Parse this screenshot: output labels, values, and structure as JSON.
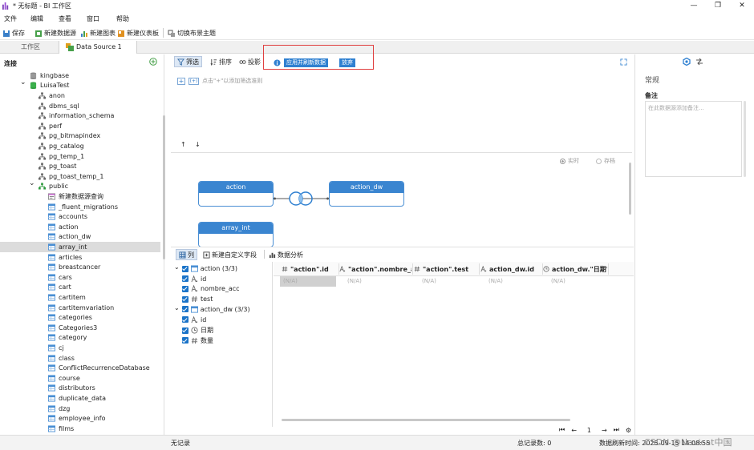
{
  "window": {
    "title": "* 无标题 - BI 工作区"
  },
  "menu": [
    "文件",
    "编辑",
    "查看",
    "窗口",
    "帮助"
  ],
  "toolbar": {
    "save": "保存",
    "new_datasource": "新建数据源",
    "new_chart": "新建图表",
    "new_dashboard": "新建仪表板",
    "switch_theme": "切换布景主题"
  },
  "tabs": {
    "workspace": "工作区",
    "datasource": "Data Source 1"
  },
  "left": {
    "title": "连接",
    "items": [
      "kingbase",
      "LuisaTest",
      "anon",
      "dbms_sql",
      "information_schema",
      "perf",
      "pg_bitmapindex",
      "pg_catalog",
      "pg_temp_1",
      "pg_toast",
      "pg_toast_temp_1",
      "public",
      "新建数据源查询",
      "_fluent_migrations",
      "accounts",
      "action",
      "action_dw",
      "array_int",
      "articles",
      "breastcancer",
      "cars",
      "cart",
      "cartitem",
      "cartitemvariation",
      "categories",
      "Categories3",
      "category",
      "cj",
      "class",
      "ConflictRecurrenceDatabase",
      "course",
      "distributors",
      "duplicate_data",
      "dzg",
      "employee_info",
      "films"
    ]
  },
  "filterbar": {
    "filter": "筛选",
    "sort": "排序",
    "project": "投影",
    "apply_refresh": "应用并刷新数据",
    "discard": "放弃"
  },
  "filter_hint": "点击\"+\"以添加筛选准则",
  "canvas": {
    "realtime": "实时",
    "stored": "存档",
    "tables": [
      "action",
      "action_dw",
      "array_int"
    ]
  },
  "bottom": {
    "columns_tab": "列",
    "new_custom_field": "新建自定义字段",
    "data_analysis": "数据分析",
    "tree": [
      {
        "label": "action (3/3)",
        "level": 0
      },
      {
        "label": "id",
        "level": 1
      },
      {
        "label": "nombre_acc",
        "level": 1
      },
      {
        "label": "test",
        "level": 1
      },
      {
        "label": "action_dw (3/3)",
        "level": 0
      },
      {
        "label": "id",
        "level": 1
      },
      {
        "label": "日期",
        "level": 1
      },
      {
        "label": "数量",
        "level": 1
      }
    ],
    "grid_headers": [
      "\"action\".id",
      "\"action\".nombre_ac",
      "\"action\".test",
      "action_dw.id",
      "action_dw.\"日期\""
    ],
    "grid_values": [
      "(N/A)",
      "(N/A)",
      "(N/A)",
      "(N/A)",
      "(N/A)"
    ],
    "page": "1"
  },
  "right": {
    "general": "常规",
    "note_label": "备注",
    "note_placeholder": "在此数据源添加备注..."
  },
  "status": {
    "left": "无记录",
    "count": "总记录数: 0",
    "refresh": "数据刷新时间: 2025-09-15 14:08:55",
    "watermark": "CSDN @Navicat中国"
  }
}
